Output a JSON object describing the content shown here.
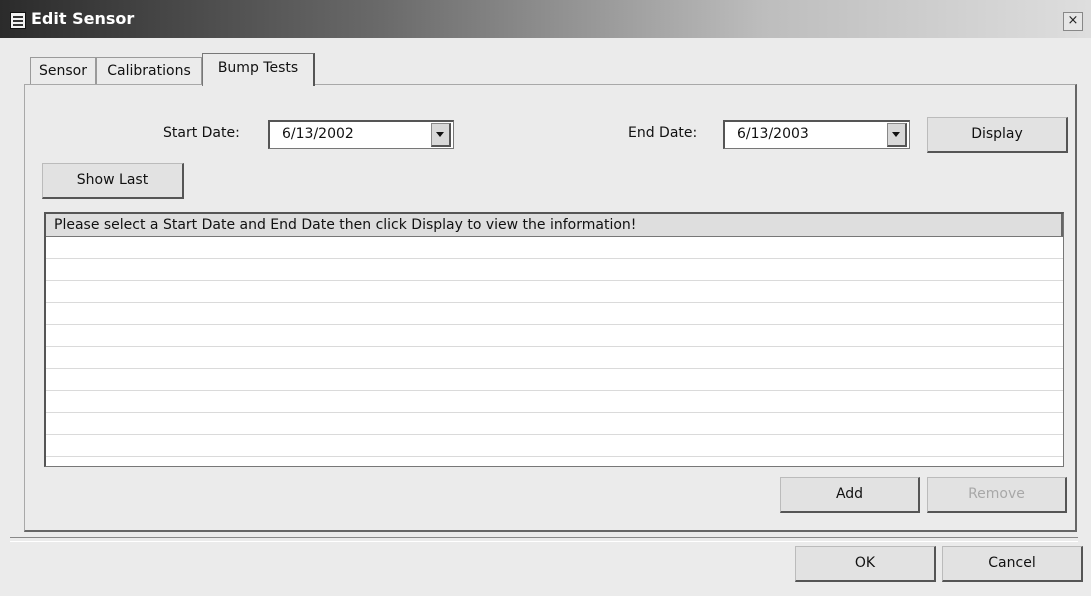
{
  "window": {
    "title": "Edit Sensor",
    "close_glyph": "×"
  },
  "tabs": [
    {
      "label": "Sensor"
    },
    {
      "label": "Calibrations"
    },
    {
      "label": "Bump Tests",
      "selected": true
    }
  ],
  "filters": {
    "start_label": "Start Date:",
    "start_value": "6/13/2002",
    "end_label": "End Date:",
    "end_value": "6/13/2003",
    "display_button": "Display",
    "show_last_button": "Show Last"
  },
  "table": {
    "message": "Please select a Start Date and End Date then click Display to view the information!"
  },
  "actions": {
    "add": "Add",
    "remove": "Remove",
    "remove_disabled": true,
    "ok": "OK",
    "cancel": "Cancel"
  }
}
